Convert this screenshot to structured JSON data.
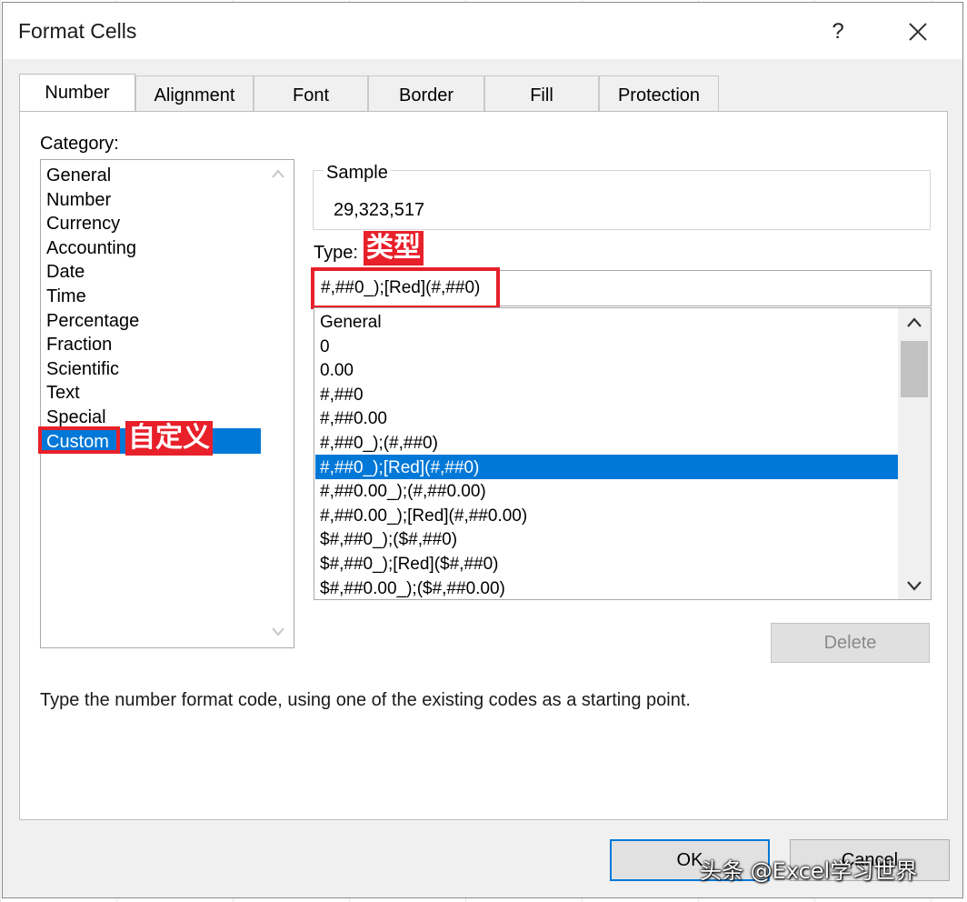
{
  "dialog": {
    "title": "Format Cells",
    "help_label": "?"
  },
  "tabs": [
    {
      "label": "Number",
      "active": true
    },
    {
      "label": "Alignment"
    },
    {
      "label": "Font"
    },
    {
      "label": "Border"
    },
    {
      "label": "Fill"
    },
    {
      "label": "Protection"
    }
  ],
  "category": {
    "label": "Category:",
    "items": [
      "General",
      "Number",
      "Currency",
      "Accounting",
      "Date",
      "Time",
      "Percentage",
      "Fraction",
      "Scientific",
      "Text",
      "Special",
      "Custom"
    ],
    "selected": "Custom"
  },
  "sample": {
    "legend": "Sample",
    "value": "29,323,517"
  },
  "type": {
    "label": "Type:",
    "value": "#,##0_);[Red](#,##0)"
  },
  "formats": {
    "items": [
      "General",
      "0",
      "0.00",
      "#,##0",
      "#,##0.00",
      "#,##0_);(#,##0)",
      "#,##0_);[Red](#,##0)",
      "#,##0.00_);(#,##0.00)",
      "#,##0.00_);[Red](#,##0.00)",
      "$#,##0_);($#,##0)",
      "$#,##0_);[Red]($#,##0)",
      "$#,##0.00_);($#,##0.00)"
    ],
    "selected_index": 6
  },
  "buttons": {
    "delete": "Delete",
    "ok": "OK",
    "cancel": "Cancel"
  },
  "hint": "Type the number format code, using one of the existing codes as a starting point.",
  "annotations": {
    "type_label": "类型",
    "custom_label": "自定义"
  },
  "watermark": "头条 @Excel学习世界",
  "colors": {
    "selection": "#0078d7",
    "annotation": "#e8202a"
  }
}
